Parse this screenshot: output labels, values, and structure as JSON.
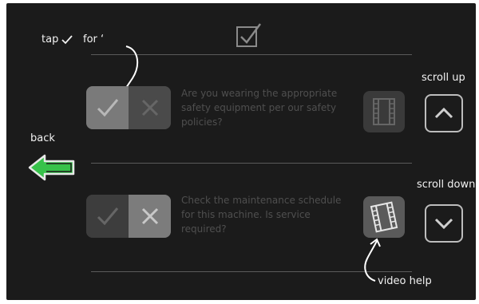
{
  "annotations": {
    "tap_label": "tap",
    "for_label": "for ‘",
    "back_label": "back",
    "scroll_up_label": "scroll up",
    "scroll_down_label": "scroll down",
    "video_help_label": "video help"
  },
  "checklist": [
    {
      "question": "Are you wearing the appropriate safety equipment per our safety policies?",
      "selected": "check"
    },
    {
      "question": "Check the maintenance schedule for this machine.  Is service required?",
      "selected": "x"
    }
  ],
  "icons": {
    "header": "checkbox-checked-icon",
    "back": "arrow-left-icon",
    "scroll_up": "chevron-up-icon",
    "scroll_down": "chevron-down-icon",
    "video": "film-icon",
    "check": "check-icon",
    "x": "x-icon"
  },
  "colors": {
    "background": "#1b1b1b",
    "back_button_green": "#37c24a",
    "text_dim": "#4f4f4f",
    "annotation": "#f2f2f2"
  }
}
